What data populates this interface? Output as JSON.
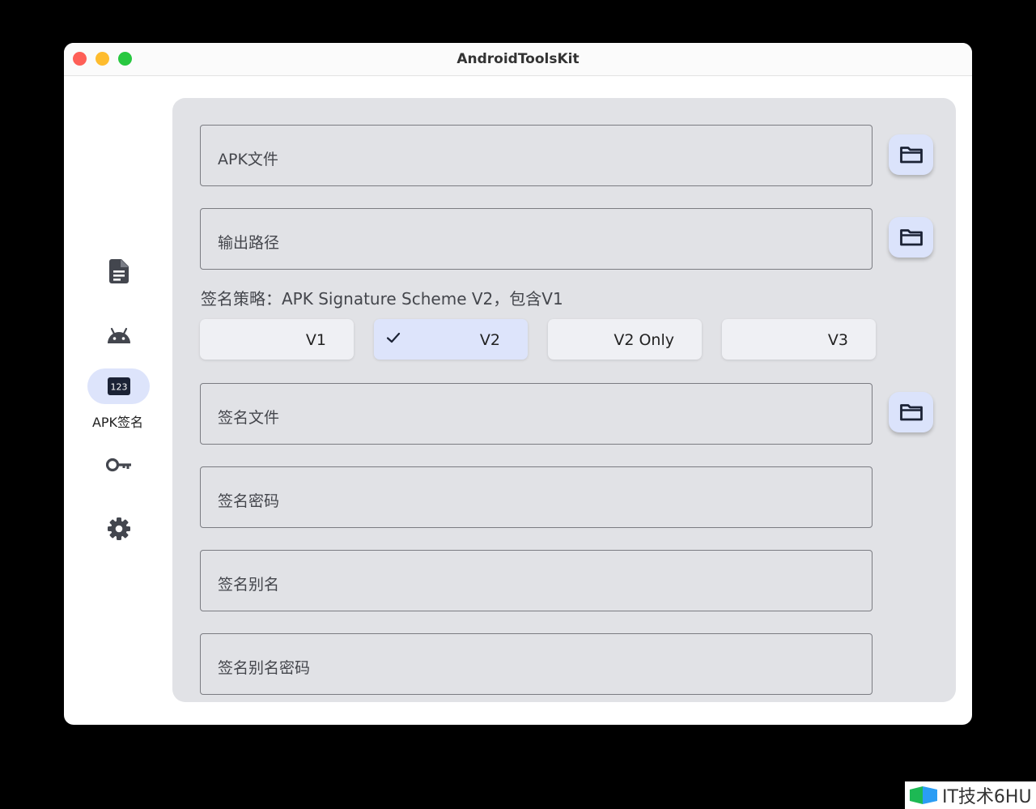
{
  "window": {
    "title": "AndroidToolsKit"
  },
  "sidebar": {
    "items": [
      {
        "icon": "document-icon",
        "label": ""
      },
      {
        "icon": "android-icon",
        "label": ""
      },
      {
        "icon": "numbers-123-icon",
        "label": "APK签名",
        "badge": "123",
        "active": true
      },
      {
        "icon": "key-icon",
        "label": ""
      },
      {
        "icon": "settings-icon",
        "label": ""
      }
    ]
  },
  "form": {
    "apk_file_label": "APK文件",
    "output_path_label": "输出路径",
    "strategy_text": "签名策略：APK Signature Scheme V2，包含V1",
    "scheme_options": [
      {
        "label": "V1",
        "selected": false
      },
      {
        "label": "V2",
        "selected": true
      },
      {
        "label": "V2 Only",
        "selected": false
      },
      {
        "label": "V3",
        "selected": false
      }
    ],
    "sign_file_label": "签名文件",
    "sign_password_label": "签名密码",
    "sign_alias_label": "签名别名",
    "sign_alias_password_label": "签名别名密码"
  },
  "watermark": {
    "text": "IT技术6HU"
  },
  "colors": {
    "accent_bg": "#dde4fb",
    "panel_bg": "#e1e2e6",
    "icon_dark": "#1b2235"
  }
}
